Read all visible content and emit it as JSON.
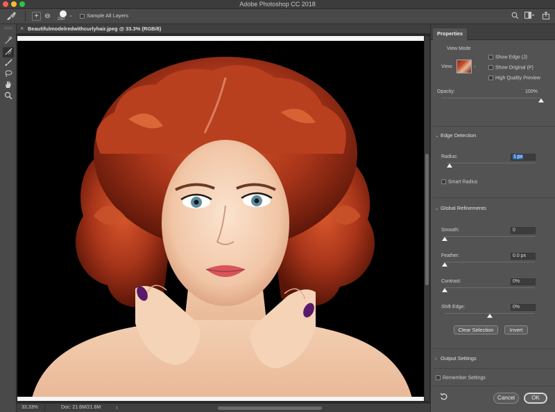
{
  "window": {
    "title": "Adobe Photoshop CC 2018"
  },
  "options_bar": {
    "tool_icon": "refine-edge-brush-icon",
    "add_icon": "plus-circle-icon",
    "subtract_icon": "minus-circle-icon",
    "brush_size": "250",
    "sample_all_layers_label": "Sample All Layers",
    "sample_all_layers_checked": false,
    "right_icons": [
      "search-icon",
      "workspace-icon",
      "share-icon"
    ]
  },
  "toolbar": {
    "tools": [
      {
        "name": "quick-selection-icon",
        "glyph": "✎",
        "active": false
      },
      {
        "name": "refine-edge-brush-icon",
        "glyph": "✎",
        "active": true
      },
      {
        "name": "brush-icon",
        "glyph": "✐",
        "active": false
      },
      {
        "name": "lasso-icon",
        "glyph": "◌",
        "active": false
      },
      {
        "name": "hand-icon",
        "glyph": "✋",
        "active": false
      },
      {
        "name": "zoom-icon",
        "glyph": "⌕",
        "active": false
      }
    ]
  },
  "document": {
    "tab_title": "Beautifulmodelredwithcurlyhair.jpeg @ 33.3% (RGB/8)"
  },
  "status_bar": {
    "zoom": "33.33%",
    "doc_info": "Doc: 21.6M/21.6M",
    "arrow": "›"
  },
  "properties": {
    "tab_label": "Properties",
    "view_mode": {
      "heading": "View Mode",
      "view_label": "View:",
      "show_edge": "Show Edge (J)",
      "show_original": "Show Original (P)",
      "high_quality_preview": "High Quality Preview"
    },
    "opacity": {
      "label": "Opacity:",
      "value": "100%",
      "level": 1.0
    },
    "edge_detection": {
      "heading": "Edge Detection",
      "radius_label": "Radius:",
      "radius_value": "1 px",
      "radius_level": 0.03,
      "smart_radius": "Smart Radius"
    },
    "global_refinements": {
      "heading": "Global Refinements",
      "smooth_label": "Smooth:",
      "smooth_value": "0",
      "smooth_level": 0.0,
      "feather_label": "Feather:",
      "feather_value": "0.0 px",
      "feather_level": 0.0,
      "contrast_label": "Contrast:",
      "contrast_value": "0%",
      "contrast_level": 0.0,
      "shift_edge_label": "Shift Edge:",
      "shift_edge_value": "0%",
      "shift_edge_level": 0.5,
      "clear_selection": "Clear Selection",
      "invert": "Invert"
    },
    "output_settings": {
      "heading": "Output Settings"
    },
    "remember_settings": "Remember Settings",
    "cancel": "Cancel",
    "ok": "OK"
  }
}
